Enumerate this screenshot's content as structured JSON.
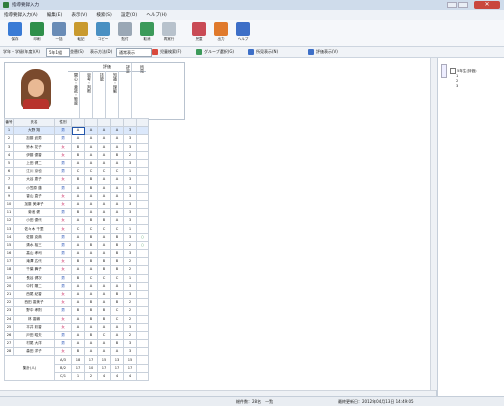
{
  "window": {
    "title": "指導要録入力"
  },
  "menu": [
    "指導要録入力(A)",
    "編集(E)",
    "表示(V)",
    "検索(S)",
    "設定(O)",
    "ヘルプ(H)"
  ],
  "toolbar": [
    {
      "label": "保存",
      "icon": "save-icon",
      "color": "#3a7bd5"
    },
    {
      "label": "印刷",
      "icon": "print-icon",
      "color": "#2f8f4a"
    },
    {
      "label": "一括",
      "icon": "batch-icon",
      "color": "#6a8cb6"
    },
    {
      "label": "転記",
      "icon": "transfer-icon",
      "color": "#c99a2e"
    },
    {
      "label": "コピー",
      "icon": "copy-icon",
      "color": "#4a90c2"
    },
    {
      "label": "貼付",
      "icon": "paste-icon",
      "color": "#9aa7b5"
    },
    {
      "label": "取消",
      "icon": "undo-icon",
      "color": "#3c9a5a"
    },
    {
      "label": "再実行",
      "icon": "redo-icon",
      "color": "#b8c2cc"
    },
    {
      "label": "児童",
      "icon": "student-icon",
      "color": "#c94b55"
    },
    {
      "label": "出力",
      "icon": "export-icon",
      "color": "#e07a2c"
    },
    {
      "label": "ヘルプ",
      "icon": "help-icon",
      "color": "#3d6fc7"
    }
  ],
  "options": {
    "year_label": "学年・学級(年度)(A)",
    "year_value": "5年1組",
    "sort_label": "並替(S)",
    "display_label": "表示方法(D)",
    "display_value": "通常表示",
    "filter_label": "児童検索(F)",
    "link1_label": "グループ選択(G)",
    "link2_label": "所見表示(N)",
    "link3_label": "評価表示(V)"
  },
  "grid": {
    "group_header": "評価",
    "columns": [
      "関心・意欲・態度",
      "思考・判断",
      "技能",
      "知識・理解"
    ],
    "extra_col": "評定",
    "last_col": "所見",
    "head_num": "番号",
    "head_name": "氏名",
    "head_gender": "性別",
    "rows": [
      {
        "num": "1",
        "name": "大野 翔",
        "g": "男",
        "v": [
          "A",
          "A",
          "A",
          "A",
          "3"
        ],
        "x": ""
      },
      {
        "num": "2",
        "name": "加藤 武男",
        "g": "男",
        "v": [
          "A",
          "A",
          "A",
          "A",
          "3"
        ],
        "x": ""
      },
      {
        "num": "3",
        "name": "鈴木 花子",
        "g": "女",
        "v": [
          "B",
          "A",
          "A",
          "A",
          "3"
        ],
        "x": ""
      },
      {
        "num": "4",
        "name": "伊藤 優香",
        "g": "女",
        "v": [
          "B",
          "A",
          "A",
          "B",
          "2"
        ],
        "x": ""
      },
      {
        "num": "5",
        "name": "上田 健二",
        "g": "男",
        "v": [
          "A",
          "A",
          "A",
          "A",
          "3"
        ],
        "x": ""
      },
      {
        "num": "6",
        "name": "江川 京也",
        "g": "男",
        "v": [
          "C",
          "C",
          "C",
          "C",
          "1"
        ],
        "x": ""
      },
      {
        "num": "7",
        "name": "大谷 恵子",
        "g": "女",
        "v": [
          "B",
          "B",
          "A",
          "A",
          "3"
        ],
        "x": ""
      },
      {
        "num": "8",
        "name": "小笠原 蓮",
        "g": "男",
        "v": [
          "A",
          "B",
          "A",
          "A",
          "3"
        ],
        "x": ""
      },
      {
        "num": "9",
        "name": "香山 直子",
        "g": "女",
        "v": [
          "A",
          "A",
          "A",
          "A",
          "3"
        ],
        "x": ""
      },
      {
        "num": "10",
        "name": "加藤 美津子",
        "g": "女",
        "v": [
          "A",
          "A",
          "A",
          "A",
          "3"
        ],
        "x": ""
      },
      {
        "num": "11",
        "name": "菊池 健",
        "g": "男",
        "v": [
          "B",
          "A",
          "A",
          "A",
          "3"
        ],
        "x": ""
      },
      {
        "num": "12",
        "name": "小田 優代",
        "g": "女",
        "v": [
          "A",
          "B",
          "B",
          "A",
          "3"
        ],
        "x": ""
      },
      {
        "num": "13",
        "name": "佐々木 千里",
        "g": "女",
        "v": [
          "C",
          "C",
          "C",
          "C",
          "1"
        ],
        "x": ""
      },
      {
        "num": "14",
        "name": "佐藤 克典",
        "g": "男",
        "v": [
          "A",
          "B",
          "A",
          "B",
          "3"
        ],
        "x": "○"
      },
      {
        "num": "15",
        "name": "清水 裕三",
        "g": "男",
        "v": [
          "A",
          "B",
          "A",
          "B",
          "2"
        ],
        "x": "○"
      },
      {
        "num": "16",
        "name": "高山 孝司",
        "g": "男",
        "v": [
          "A",
          "A",
          "A",
          "B",
          "3"
        ],
        "x": ""
      },
      {
        "num": "17",
        "name": "滝澤 広代",
        "g": "女",
        "v": [
          "B",
          "B",
          "B",
          "B",
          "2"
        ],
        "x": ""
      },
      {
        "num": "18",
        "name": "千葉 舞子",
        "g": "女",
        "v": [
          "A",
          "A",
          "B",
          "B",
          "2"
        ],
        "x": ""
      },
      {
        "num": "19",
        "name": "長谷 健次",
        "g": "男",
        "v": [
          "B",
          "C",
          "C",
          "C",
          "1"
        ],
        "x": ""
      },
      {
        "num": "20",
        "name": "中村 陽二",
        "g": "男",
        "v": [
          "A",
          "A",
          "A",
          "A",
          "3"
        ],
        "x": ""
      },
      {
        "num": "21",
        "name": "西尾 紀香",
        "g": "女",
        "v": [
          "A",
          "A",
          "A",
          "B",
          "3"
        ],
        "x": ""
      },
      {
        "num": "22",
        "name": "西田 香美子",
        "g": "女",
        "v": [
          "A",
          "B",
          "A",
          "B",
          "2"
        ],
        "x": ""
      },
      {
        "num": "23",
        "name": "野中 孝則",
        "g": "男",
        "v": [
          "B",
          "B",
          "B",
          "C",
          "2"
        ],
        "x": ""
      },
      {
        "num": "24",
        "name": "林 香織",
        "g": "女",
        "v": [
          "A",
          "B",
          "B",
          "C",
          "2"
        ],
        "x": ""
      },
      {
        "num": "25",
        "name": "平井 彩香",
        "g": "女",
        "v": [
          "A",
          "A",
          "A",
          "A",
          "3"
        ],
        "x": ""
      },
      {
        "num": "26",
        "name": "戸田 昭夫",
        "g": "男",
        "v": [
          "A",
          "B",
          "C",
          "A",
          "2"
        ],
        "x": ""
      },
      {
        "num": "27",
        "name": "村尾 大洋",
        "g": "男",
        "v": [
          "A",
          "A",
          "A",
          "B",
          "3"
        ],
        "x": ""
      },
      {
        "num": "28",
        "name": "森田 洋子",
        "g": "女",
        "v": [
          "B",
          "A",
          "A",
          "A",
          "3"
        ],
        "x": ""
      }
    ],
    "summary_label": "集計(人)",
    "summary": [
      {
        "k": "A/3",
        "v": [
          "18",
          "17",
          "15",
          "13",
          "15"
        ]
      },
      {
        "k": "B/2",
        "v": [
          "17",
          "10",
          "17",
          "17",
          "17"
        ]
      },
      {
        "k": "C/1",
        "v": [
          "1",
          "2",
          "4",
          "4",
          "4"
        ]
      }
    ]
  },
  "side": {
    "tree_root": "5年生(評価)",
    "tree_items": [
      "1",
      "2",
      "3"
    ]
  },
  "status": {
    "left": "総件数：28名　一覧",
    "right": "最終更新日：2012年04月13日 14:49:05"
  }
}
